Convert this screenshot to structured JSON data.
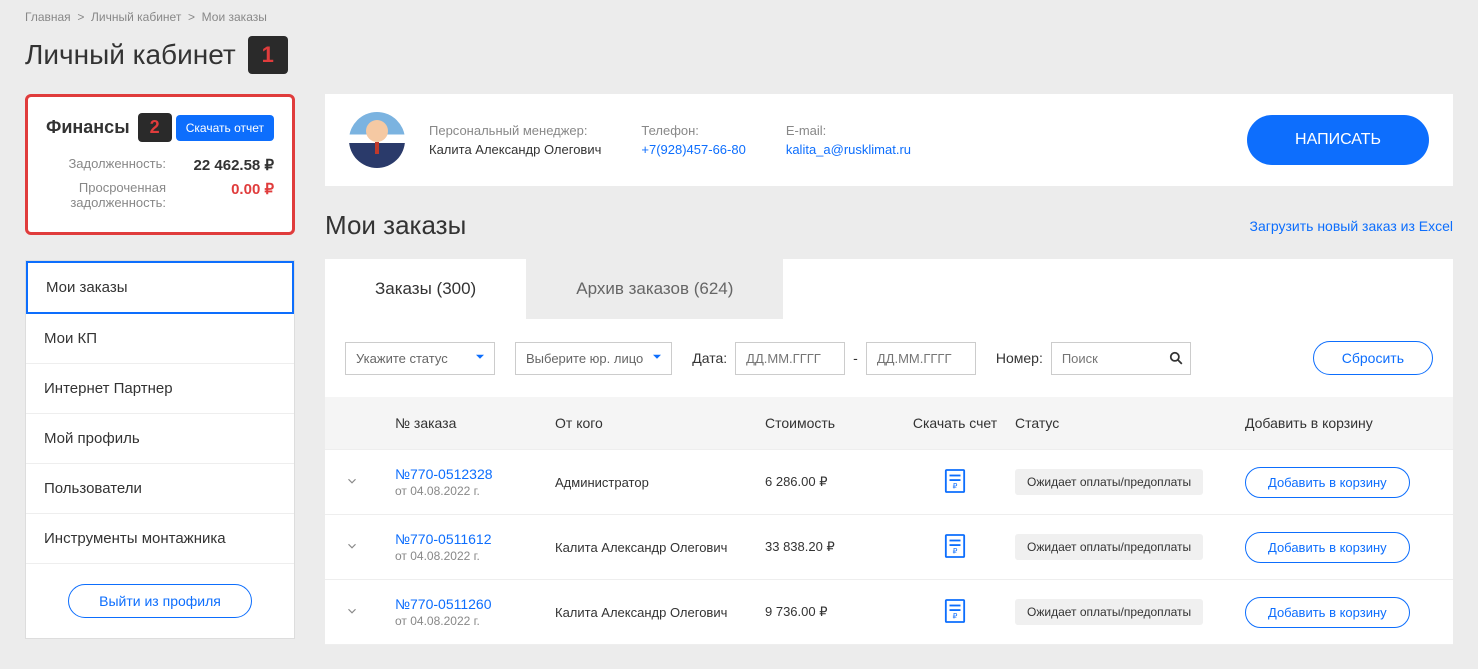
{
  "breadcrumb": [
    "Главная",
    "Личный кабинет",
    "Мои заказы"
  ],
  "page_title": "Личный кабинет",
  "annotation1": "1",
  "annotation2": "2",
  "finance": {
    "title": "Финансы",
    "download_report": "Скачать отчет",
    "debt_label": "Задолженность:",
    "debt_value": "22 462.58 ₽",
    "overdue_label": "Просроченная задолженность:",
    "overdue_value": "0.00 ₽"
  },
  "sidebar_menu": [
    "Мои заказы",
    "Мои КП",
    "Интернет Партнер",
    "Мой профиль",
    "Пользователи",
    "Инструменты монтажника"
  ],
  "logout": "Выйти из профиля",
  "manager": {
    "label": "Персональный менеджер:",
    "name": "Калита Александр Олегович",
    "phone_label": "Телефон:",
    "phone": "+7(928)457-66-80",
    "email_label": "E-mail:",
    "email": "kalita_a@rusklimat.ru",
    "write": "НАПИСАТЬ"
  },
  "orders_title": "Мои заказы",
  "upload_link": "Загрузить новый заказ из Excel",
  "tabs": {
    "orders": "Заказы (300)",
    "archive": "Архив заказов (624)"
  },
  "filters": {
    "status_placeholder": "Укажите статус",
    "entity_placeholder": "Выберите юр. лицо",
    "date_label": "Дата:",
    "date_placeholder": "ДД.ММ.ГГГГ",
    "dash": "-",
    "number_label": "Номер:",
    "search_placeholder": "Поиск",
    "reset": "Сбросить"
  },
  "headers": {
    "num": "№ заказа",
    "from": "От кого",
    "cost": "Стоимость",
    "invoice": "Скачать счет",
    "status": "Статус",
    "cart": "Добавить в корзину"
  },
  "rows": [
    {
      "num": "№770-0512328",
      "date": "от 04.08.2022 г.",
      "from": "Администратор",
      "cost": "6 286.00 ₽",
      "status": "Ожидает оплаты/предоплаты",
      "cart": "Добавить в корзину"
    },
    {
      "num": "№770-0511612",
      "date": "от 04.08.2022 г.",
      "from": "Калита Александр Олегович",
      "cost": "33 838.20 ₽",
      "status": "Ожидает оплаты/предоплаты",
      "cart": "Добавить в корзину"
    },
    {
      "num": "№770-0511260",
      "date": "от 04.08.2022 г.",
      "from": "Калита Александр Олегович",
      "cost": "9 736.00 ₽",
      "status": "Ожидает оплаты/предоплаты",
      "cart": "Добавить в корзину"
    }
  ]
}
